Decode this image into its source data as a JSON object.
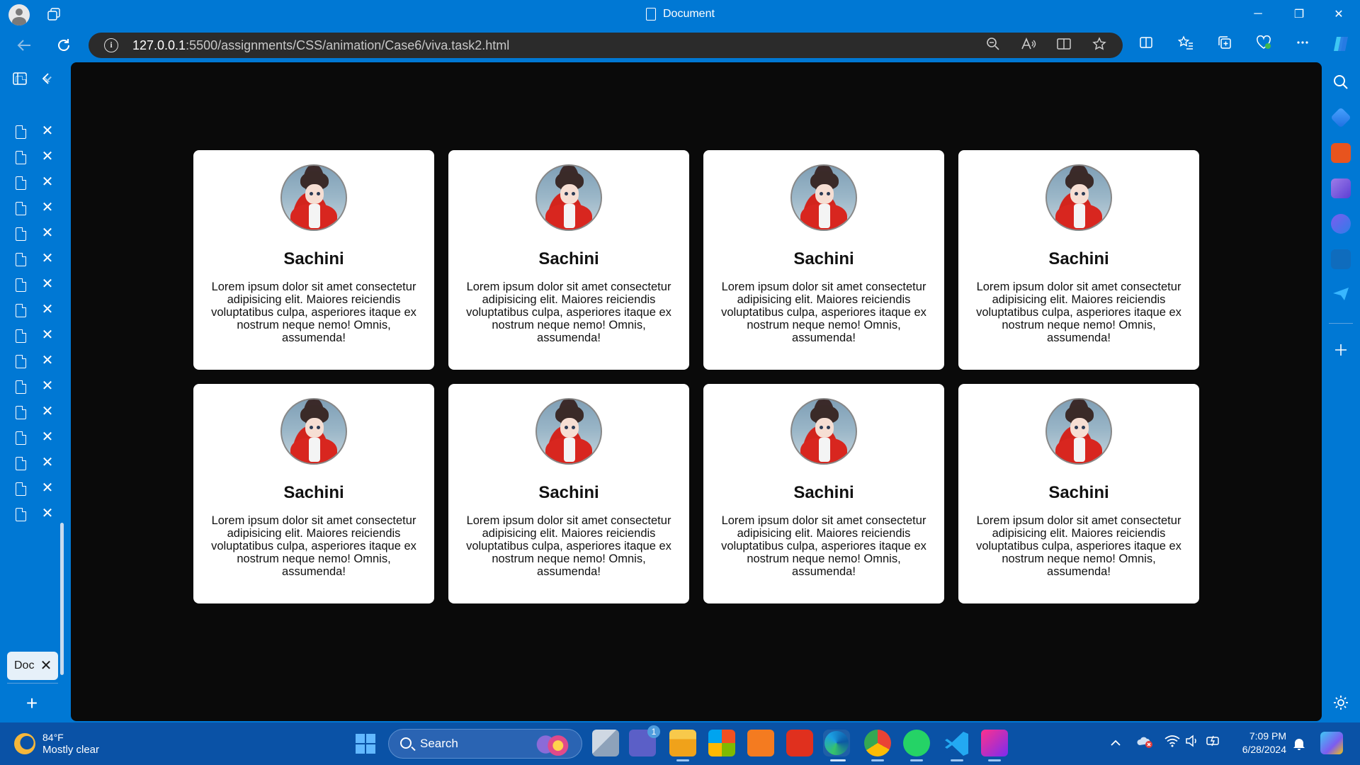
{
  "window": {
    "title": "Document",
    "minimize": "─",
    "restore": "❐",
    "close": "✕"
  },
  "nav": {
    "url_host": "127.0.0.1",
    "url_path": ":5500/assignments/CSS/animation/Case6/viva.task2.html",
    "info": "i"
  },
  "sidebar": {
    "active_tab_label": "Doc",
    "close_glyph": "✕",
    "new_tab_glyph": "+"
  },
  "cards": [
    {
      "name": "Sachini",
      "text": "Lorem ipsum dolor sit amet consectetur adipisicing elit. Maiores reiciendis voluptatibus culpa, asperiores itaque ex nostrum neque nemo! Omnis, assumenda!"
    },
    {
      "name": "Sachini",
      "text": "Lorem ipsum dolor sit amet consectetur adipisicing elit. Maiores reiciendis voluptatibus culpa, asperiores itaque ex nostrum neque nemo! Omnis, assumenda!"
    },
    {
      "name": "Sachini",
      "text": "Lorem ipsum dolor sit amet consectetur adipisicing elit. Maiores reiciendis voluptatibus culpa, asperiores itaque ex nostrum neque nemo! Omnis, assumenda!"
    },
    {
      "name": "Sachini",
      "text": "Lorem ipsum dolor sit amet consectetur adipisicing elit. Maiores reiciendis voluptatibus culpa, asperiores itaque ex nostrum neque nemo! Omnis, assumenda!"
    },
    {
      "name": "Sachini",
      "text": "Lorem ipsum dolor sit amet consectetur adipisicing elit. Maiores reiciendis voluptatibus culpa, asperiores itaque ex nostrum neque nemo! Omnis, assumenda!"
    },
    {
      "name": "Sachini",
      "text": "Lorem ipsum dolor sit amet consectetur adipisicing elit. Maiores reiciendis voluptatibus culpa, asperiores itaque ex nostrum neque nemo! Omnis, assumenda!"
    },
    {
      "name": "Sachini",
      "text": "Lorem ipsum dolor sit amet consectetur adipisicing elit. Maiores reiciendis voluptatibus culpa, asperiores itaque ex nostrum neque nemo! Omnis, assumenda!"
    },
    {
      "name": "Sachini",
      "text": "Lorem ipsum dolor sit amet consectetur adipisicing elit. Maiores reiciendis voluptatibus culpa, asperiores itaque ex nostrum neque nemo! Omnis, assumenda!"
    }
  ],
  "taskbar": {
    "weather_temp": "84°F",
    "weather_desc": "Mostly clear",
    "search_label": "Search",
    "teams_badge": "1",
    "time": "7:09 PM",
    "date": "6/28/2024"
  },
  "colors": {
    "titlebar": "#0078d4",
    "page_background": "#0a0a0a",
    "card_background": "#ffffff",
    "taskbar": "#0a52a6"
  }
}
